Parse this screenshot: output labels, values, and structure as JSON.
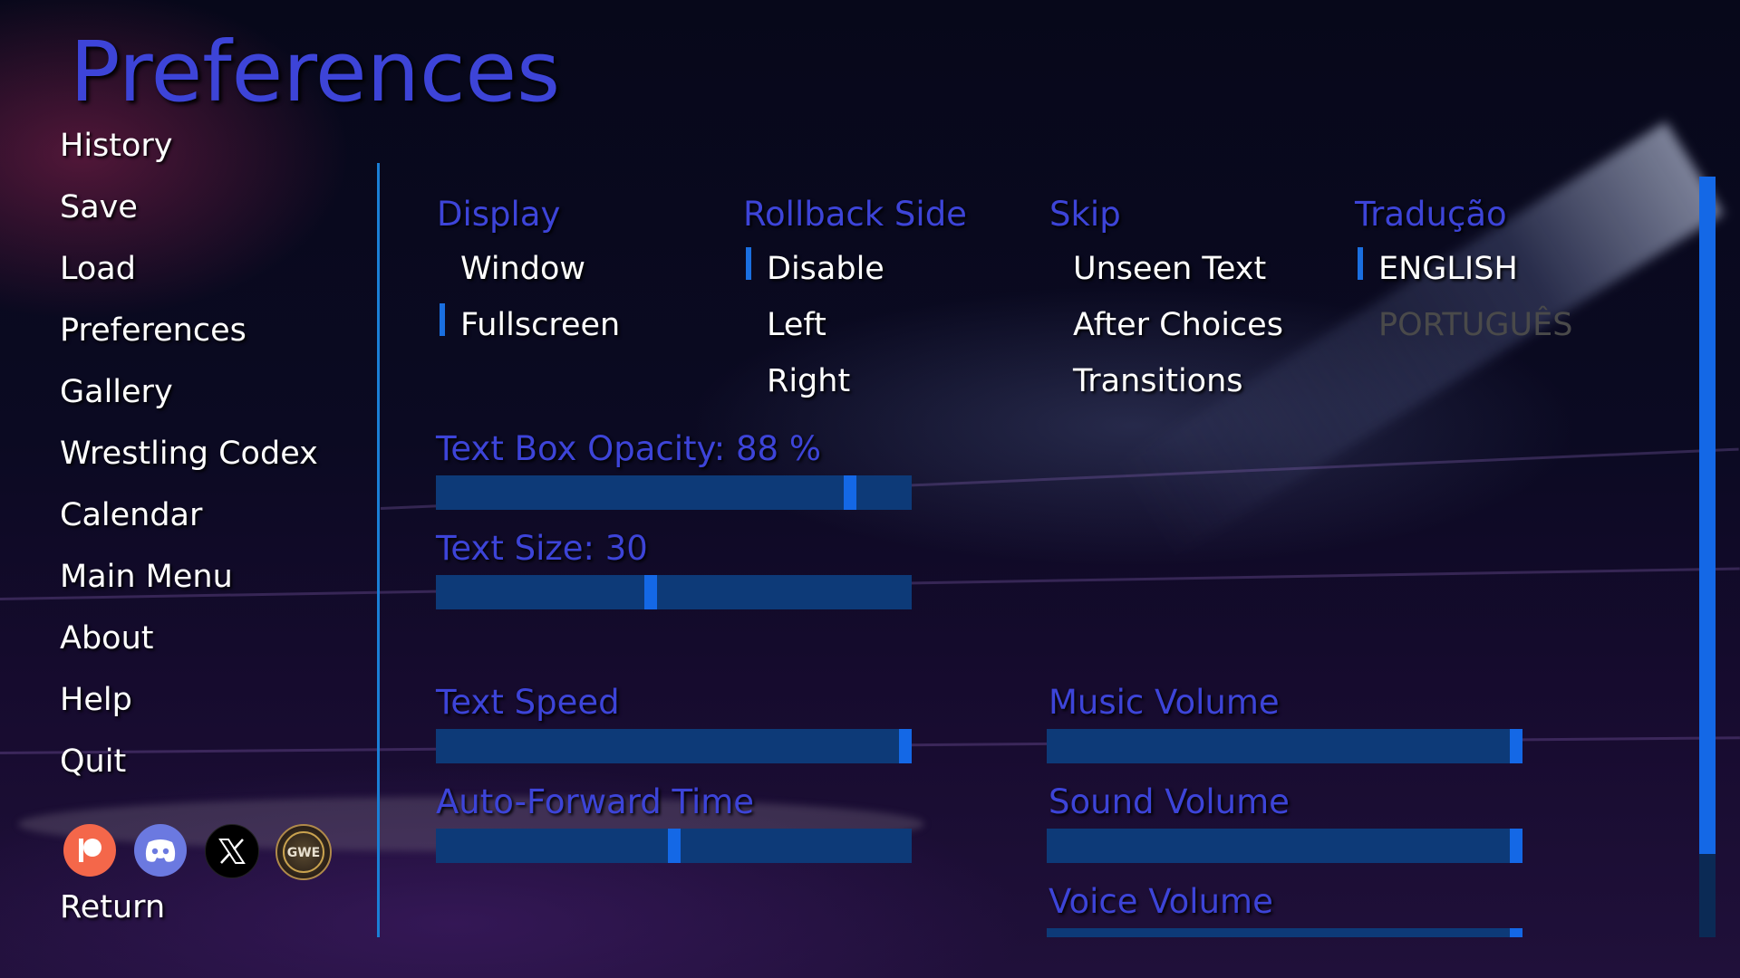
{
  "title": "Preferences",
  "nav": {
    "items": [
      "History",
      "Save",
      "Load",
      "Preferences",
      "Gallery",
      "Wrestling Codex",
      "Calendar",
      "Main Menu",
      "About",
      "Help",
      "Quit"
    ],
    "return_label": "Return"
  },
  "social": {
    "icons": [
      "patreon-icon",
      "discord-icon",
      "x-icon",
      "gwe-logo-icon"
    ],
    "gwe_text": "GWE"
  },
  "display": {
    "label": "Display",
    "options": [
      "Window",
      "Fullscreen"
    ],
    "selected": "Fullscreen"
  },
  "rollback": {
    "label": "Rollback Side",
    "options": [
      "Disable",
      "Left",
      "Right"
    ],
    "selected": "Disable"
  },
  "skip": {
    "label": "Skip",
    "options": [
      "Unseen Text",
      "After Choices",
      "Transitions"
    ]
  },
  "language": {
    "label": "Tradução",
    "options": [
      "ENGLISH",
      "PORTUGUÊS"
    ],
    "selected": "ENGLISH"
  },
  "sliders": {
    "text_box_opacity": {
      "label": "Text Box Opacity: 88 %",
      "value": 0.88
    },
    "text_size": {
      "label": "Text Size: 30",
      "value": 0.45
    },
    "text_speed": {
      "label": "Text Speed",
      "value": 1.0
    },
    "auto_forward": {
      "label": "Auto-Forward Time",
      "value": 0.5
    },
    "music_volume": {
      "label": "Music Volume",
      "value": 1.0
    },
    "sound_volume": {
      "label": "Sound Volume",
      "value": 1.0
    },
    "voice_volume": {
      "label": "Voice Volume",
      "value": 1.0
    }
  },
  "colors": {
    "accent": "#3d44d8",
    "slider_track": "#0d3a78",
    "slider_thumb": "#1468e6",
    "divider": "#1a7fd6"
  },
  "scrollbar": {
    "position": 0.0,
    "visible_fraction": 0.89
  }
}
